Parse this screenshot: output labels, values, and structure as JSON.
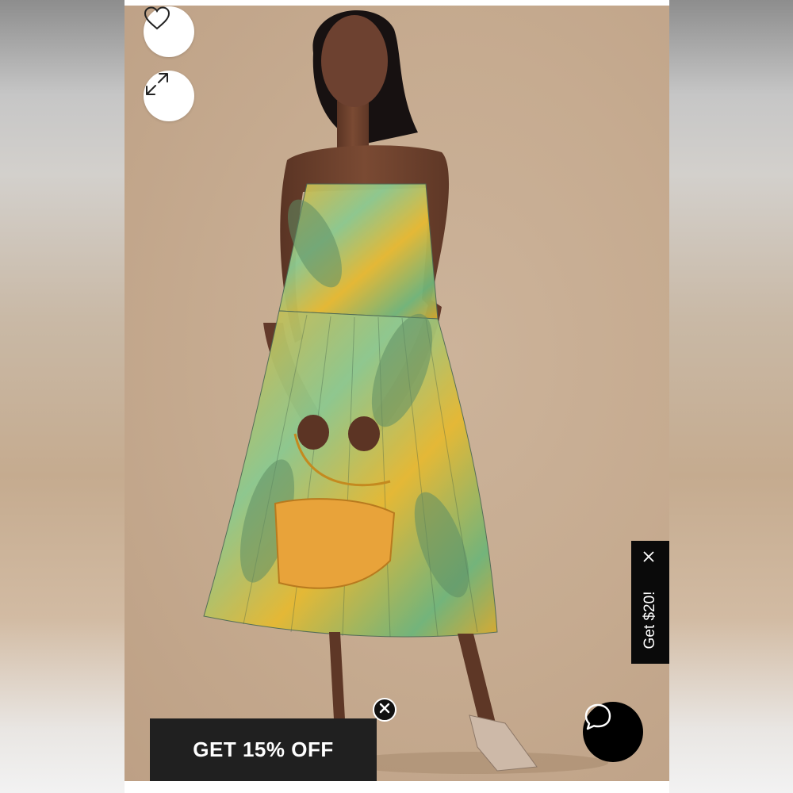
{
  "product_image": {
    "alt": "Model wearing yellow and green tropical print pleated midi dress with yellow handbag"
  },
  "actions": {
    "favorite_icon": "heart-outline",
    "expand_icon": "expand-arrows"
  },
  "promo": {
    "banner_text": "GET 15% OFF",
    "close_icon": "close-circle"
  },
  "side_tab": {
    "label": "Get $20!",
    "close_icon": "close-x"
  },
  "chat": {
    "icon": "chat-bubble"
  },
  "colors": {
    "backdrop": "#c6ab90",
    "promo_bg": "#202020",
    "tab_bg": "#0a0a0a",
    "dress_yellow": "#e3b73a",
    "dress_green": "#7fbf86"
  }
}
